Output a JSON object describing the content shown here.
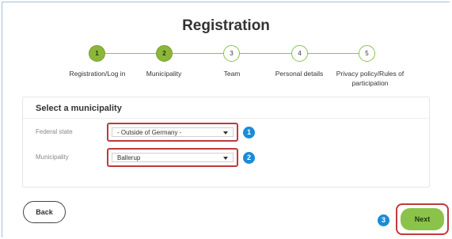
{
  "page": {
    "title": "Registration"
  },
  "steps": [
    {
      "number": "1",
      "label": "Registration/Log in",
      "status": "done"
    },
    {
      "number": "2",
      "label": "Municipality",
      "status": "done"
    },
    {
      "number": "3",
      "label": "Team",
      "status": "todo"
    },
    {
      "number": "4",
      "label": "Personal details",
      "status": "todo"
    },
    {
      "number": "5",
      "label": "Privacy policy/Rules of participation",
      "status": "todo"
    }
  ],
  "form": {
    "section_title": "Select a municipality",
    "federal_state": {
      "label": "Federal state",
      "value": "- Outside of Germany -"
    },
    "municipality": {
      "label": "Municipality",
      "value": "Ballerup"
    }
  },
  "callouts": [
    "1",
    "2",
    "3"
  ],
  "buttons": {
    "back": "Back",
    "next": "Next"
  },
  "colors": {
    "accent_green": "#8bc34a",
    "highlight_red": "#c0393e",
    "callout_blue": "#1a8cd8"
  }
}
